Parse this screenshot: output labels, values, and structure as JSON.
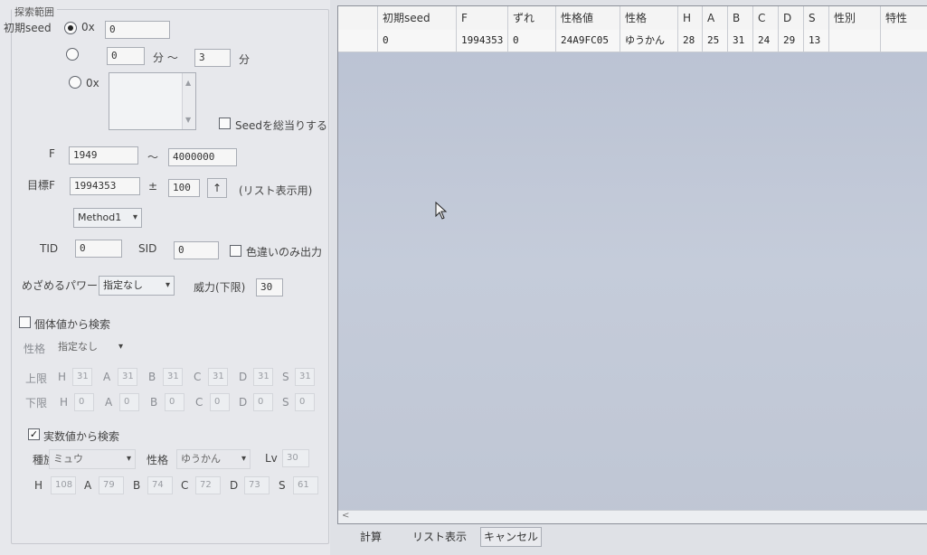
{
  "group_title": "探索範囲",
  "seed_row": {
    "label": "初期seed",
    "radio_hex_prefix": "0x",
    "hex_value": "0",
    "min_from": "0",
    "min_sep": "分 〜",
    "min_to": "3",
    "min_unit": "分",
    "list_prefix": "0x",
    "bruteforce_label": "Seedを総当りする"
  },
  "f_row": {
    "label": "F",
    "from": "1949",
    "sep": "〜",
    "to": "4000000"
  },
  "target_row": {
    "label": "目標F",
    "value": "1994353",
    "pm": "±",
    "range": "100",
    "arrow_button": "↑",
    "note": "(リスト表示用)"
  },
  "method_select": "Method1",
  "tid_row": {
    "tid_label": "TID",
    "tid_value": "0",
    "sid_label": "SID",
    "sid_value": "0",
    "shiny_label": "色違いのみ出力"
  },
  "hidden_power": {
    "label": "めざめるパワー",
    "value": "指定なし",
    "power_label": "威力(下限)",
    "power_value": "30"
  },
  "iv_search": {
    "label": "個体値から検索",
    "checked": false,
    "nature_label": "性格",
    "nature_value": "指定なし",
    "upper_label": "上限",
    "lower_label": "下限",
    "stat_names": [
      "H",
      "A",
      "B",
      "C",
      "D",
      "S"
    ],
    "upper_values": [
      "31",
      "31",
      "31",
      "31",
      "31",
      "31"
    ],
    "lower_values": [
      "0",
      "0",
      "0",
      "0",
      "0",
      "0"
    ]
  },
  "stat_search": {
    "label": "実数値から検索",
    "checked": true,
    "species_label": "種族",
    "species_value": "ミュウ",
    "nature_label": "性格",
    "nature_value": "ゆうかん",
    "level_label": "Lv",
    "level_value": "30",
    "stat_names": [
      "H",
      "A",
      "B",
      "C",
      "D",
      "S"
    ],
    "stat_values": [
      "108",
      "79",
      "74",
      "72",
      "73",
      "61"
    ]
  },
  "results": {
    "columns": [
      "",
      "初期seed",
      "F",
      "ずれ",
      "性格値",
      "性格",
      "H",
      "A",
      "B",
      "C",
      "D",
      "S",
      "性別",
      "特性"
    ],
    "rows": [
      [
        "",
        "0",
        "1994353",
        "0",
        "24A9FC05",
        "ゆうかん",
        "28",
        "25",
        "31",
        "24",
        "29",
        "13",
        "",
        ""
      ]
    ]
  },
  "buttons": {
    "calc": "計算",
    "list": "リスト表示",
    "cancel": "キャンセル"
  },
  "colors": {
    "grid_background": "#c2c9d7",
    "panel_background": "#e7e8ec"
  }
}
